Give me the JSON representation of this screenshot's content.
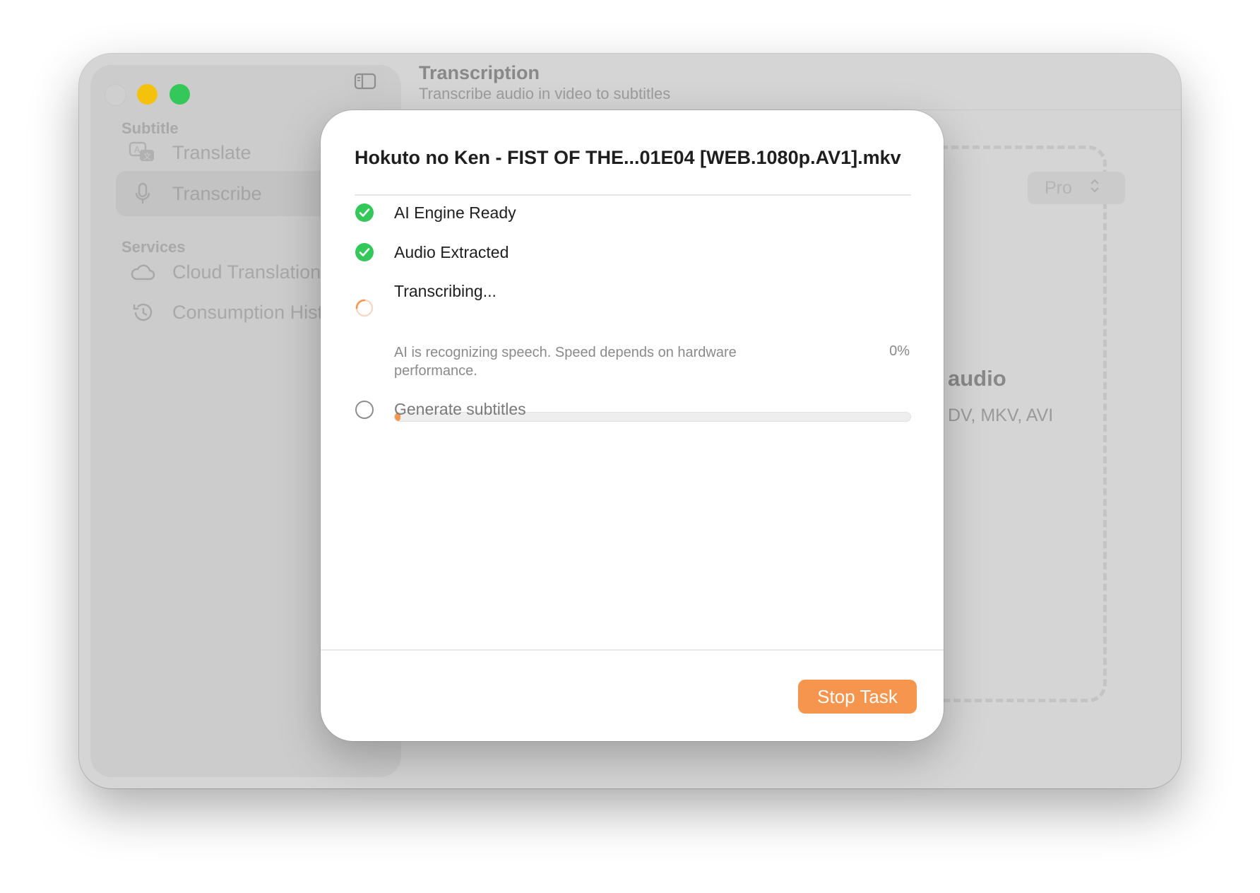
{
  "window": {
    "title": "Transcription",
    "subtitle": "Transcribe audio in video to subtitles"
  },
  "sidebar": {
    "sections": [
      {
        "label": "Subtitle",
        "items": [
          {
            "label": "Translate",
            "icon": "translate-icon"
          },
          {
            "label": "Transcribe",
            "icon": "microphone-icon",
            "selected": true
          }
        ]
      },
      {
        "label": "Services",
        "items": [
          {
            "label": "Cloud Translation",
            "icon": "cloud-icon"
          },
          {
            "label": "Consumption Histo",
            "icon": "history-icon"
          }
        ]
      }
    ]
  },
  "background": {
    "model_select": "Pro",
    "dropzone_title": "audio",
    "dropzone_formats": "DV, MKV, AVI"
  },
  "modal": {
    "file_name": "Hokuto no Ken - FIST OF THE...01E04 [WEB.1080p.AV1].mkv",
    "steps": [
      {
        "label": "AI Engine Ready",
        "status": "done"
      },
      {
        "label": "Audio Extracted",
        "status": "done"
      },
      {
        "label": "Transcribing...",
        "status": "in-progress",
        "description": "AI is recognizing speech. Speed depends on hardware performance.",
        "percent_text": "0%",
        "progress": 0.0
      },
      {
        "label": "Generate subtitles",
        "status": "pending"
      }
    ],
    "stop_button": "Stop Task"
  },
  "colors": {
    "accent": "#f5954e",
    "success": "#34c759",
    "traffic_min": "#f4c20d",
    "traffic_max": "#34c759"
  }
}
